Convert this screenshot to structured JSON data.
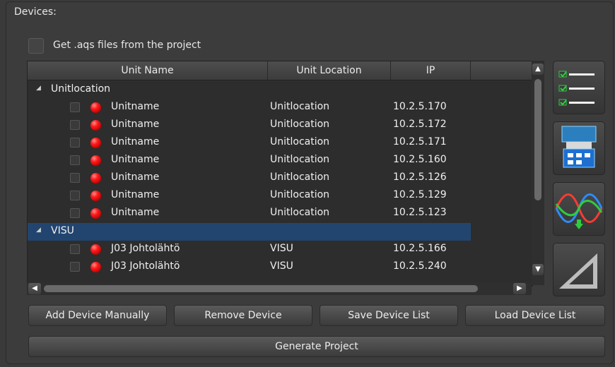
{
  "section_title": "Devices:",
  "get_aqs_label": "Get .aqs files from the project",
  "columns": [
    "Unit Name",
    "Unit Location",
    "IP"
  ],
  "groups": [
    {
      "name": "Unitlocation",
      "rows": [
        {
          "name": "Unitname",
          "location": "Unitlocation",
          "ip": "10.2.5.170"
        },
        {
          "name": "Unitname",
          "location": "Unitlocation",
          "ip": "10.2.5.172"
        },
        {
          "name": "Unitname",
          "location": "Unitlocation",
          "ip": "10.2.5.171"
        },
        {
          "name": "Unitname",
          "location": "Unitlocation",
          "ip": "10.2.5.160"
        },
        {
          "name": "Unitname",
          "location": "Unitlocation",
          "ip": "10.2.5.126"
        },
        {
          "name": "Unitname",
          "location": "Unitlocation",
          "ip": "10.2.5.129"
        },
        {
          "name": "Unitname",
          "location": "Unitlocation",
          "ip": "10.2.5.123"
        }
      ]
    },
    {
      "name": "VISU",
      "selected": true,
      "rows": [
        {
          "name": "J03 Johtolähtö",
          "location": "VISU",
          "ip": "10.2.5.166"
        },
        {
          "name": "J03 Johtolähtö",
          "location": "VISU",
          "ip": "10.2.5.240"
        }
      ]
    }
  ],
  "buttons": {
    "add": "Add Device Manually",
    "remove": "Remove Device",
    "save": "Save Device List",
    "load": "Load Device List",
    "generate": "Generate Project"
  },
  "side_icons": [
    "checklist-icon",
    "device-panel-icon",
    "waveform-download-icon",
    "logo-icon"
  ],
  "colors": {
    "selected_row": "#22456f",
    "status_led": "#e00000"
  }
}
